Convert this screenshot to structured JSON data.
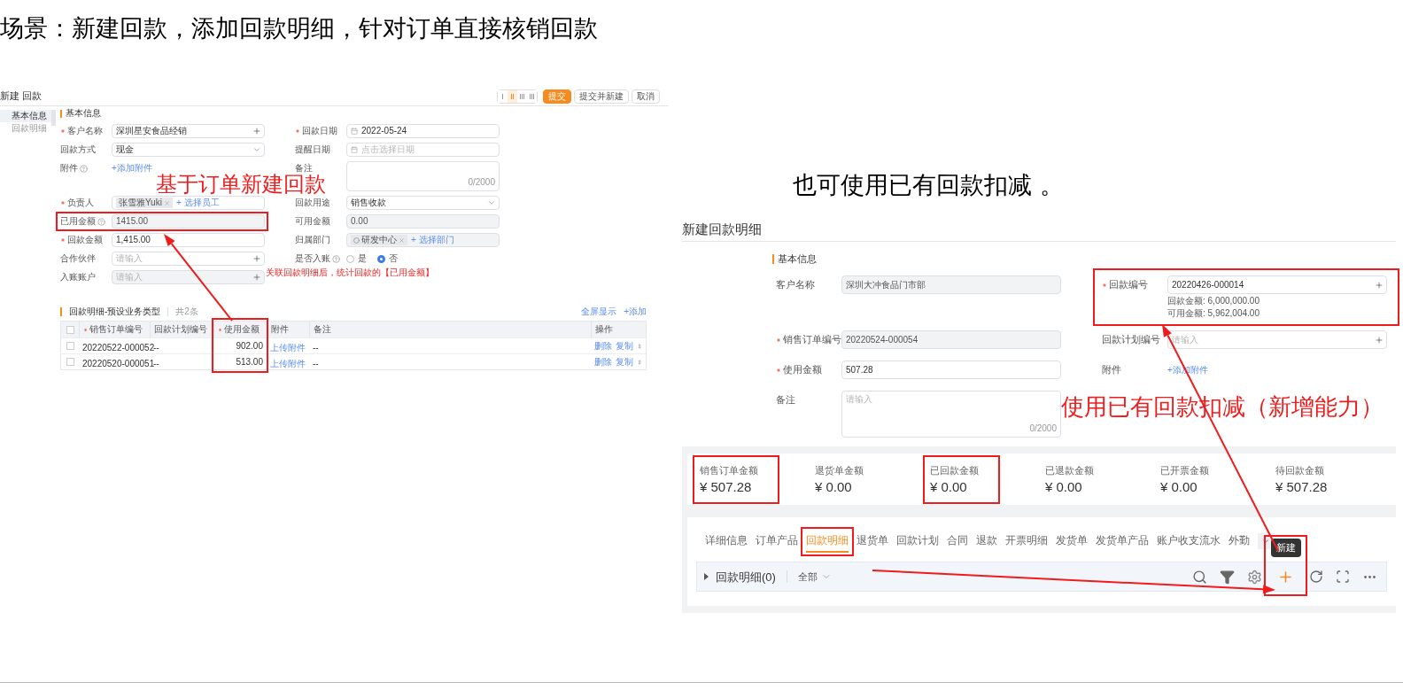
{
  "title": "场景：新建回款，添加回款明细，针对订单直接核销回款",
  "left_screen": {
    "title": "新建 回款",
    "layout_options": [
      {
        "selected": false
      },
      {
        "selected": true
      },
      {
        "selected": false
      },
      {
        "selected": false
      }
    ],
    "actions": [
      {
        "label": "提交",
        "kind": "primary"
      },
      {
        "label": "提交并新建",
        "kind": "default"
      },
      {
        "label": "取消",
        "kind": "default"
      }
    ],
    "nav": [
      {
        "label": "基本信息",
        "selected": true
      },
      {
        "label": "回款明细",
        "selected": false
      }
    ],
    "section": "基本信息",
    "rows": [
      {
        "left": {
          "label": "客户名称",
          "required": true,
          "kind": "plus",
          "value": "深圳星安食品经销"
        },
        "right": {
          "label": "回款日期",
          "required": true,
          "kind": "date",
          "value": "2022-05-24"
        }
      },
      {
        "left": {
          "label": "回款方式",
          "required": false,
          "kind": "select",
          "value": "现金"
        },
        "right": {
          "label": "提醒日期",
          "required": false,
          "kind": "date",
          "placeholder": "点击选择日期"
        }
      },
      {
        "left": {
          "label": "附件",
          "required": false,
          "help": true,
          "kind": "link",
          "value": "+添加附件"
        },
        "right": {
          "label": "备注",
          "required": false,
          "kind": "textarea",
          "count": "0/2000"
        }
      },
      {
        "left": {
          "label": "负责人",
          "required": true,
          "kind": "tags",
          "tags": [
            "张雪雅Yuki"
          ],
          "value": "+ 选择员工"
        },
        "right": {
          "label": "回款用途",
          "required": false,
          "kind": "select",
          "value": "销售收款"
        }
      },
      {
        "left": {
          "label": "已用金额",
          "required": false,
          "help": true,
          "kind": "input",
          "disabled": true,
          "highlighted": true,
          "value": "1415.00"
        },
        "right": {
          "label": "可用金额",
          "required": false,
          "kind": "input",
          "disabled": true,
          "value": "0.00"
        }
      },
      {
        "left": {
          "label": "回款金额",
          "required": true,
          "kind": "input",
          "value": "1,415.00"
        },
        "right": {
          "label": "归属部门",
          "required": false,
          "kind": "tags",
          "disabled": true,
          "tags": [
            "研发中心"
          ],
          "value": "+ 选择部门"
        }
      },
      {
        "left": {
          "label": "合作伙伴",
          "required": false,
          "kind": "plus",
          "placeholder": "请输入"
        },
        "right": {
          "label": "是否入账",
          "required": false,
          "help": true,
          "kind": "radio",
          "options": [
            {
              "label": "是",
              "selected": false
            },
            {
              "label": "否",
              "selected": true
            }
          ]
        }
      },
      {
        "left": {
          "label": "入账账户",
          "required": false,
          "kind": "plus",
          "disabled": true,
          "placeholder": "请输入"
        }
      }
    ],
    "detail_table": {
      "title": "回款明细-预设业务类型",
      "count": "共2条",
      "select_all_checked": false,
      "links": [
        "全屏显示",
        "+添加"
      ],
      "columns": [
        {
          "label": "销售订单编号",
          "required": true,
          "kind": "text"
        },
        {
          "label": "回款计划编号",
          "required": false,
          "kind": "text"
        },
        {
          "label": "使用金额",
          "required": true,
          "kind": "number",
          "highlighted": true
        },
        {
          "label": "附件",
          "required": false,
          "kind": "link"
        },
        {
          "label": "备注",
          "required": false,
          "kind": "text"
        },
        {
          "label": "操作",
          "required": false,
          "kind": "actions"
        }
      ],
      "rows": [
        {
          "checked": false,
          "cells": [
            "20220522-000052",
            "--",
            "902.00",
            "上传附件",
            "--"
          ],
          "actions": [
            "删除",
            "复制"
          ]
        },
        {
          "checked": false,
          "cells": [
            "20220520-000051",
            "--",
            "513.00",
            "上传附件",
            "--"
          ],
          "actions": [
            "删除",
            "复制"
          ]
        }
      ]
    }
  },
  "right_screen": {
    "title": "新建回款明细",
    "section": "基本信息",
    "rows": [
      {
        "left": {
          "label": "客户名称",
          "required": false,
          "kind": "input",
          "disabled": true,
          "value": "深圳大冲食品门市部"
        },
        "right": {
          "label": "回款编号",
          "required": true,
          "kind": "plus",
          "highlighted": true,
          "value": "20220426-000014",
          "notes": [
            "回款金额: 6,000,000.00",
            "可用金额: 5,962,004.00"
          ]
        }
      },
      {
        "left": {
          "label": "销售订单编号",
          "required": true,
          "kind": "input",
          "disabled": true,
          "value": "20220524-000054"
        },
        "right": {
          "label": "回款计划编号",
          "required": false,
          "kind": "plus",
          "placeholder": "请输入"
        }
      },
      {
        "left": {
          "label": "使用金额",
          "required": true,
          "kind": "input",
          "value": "507.28"
        },
        "right": {
          "label": "附件",
          "required": false,
          "kind": "link",
          "value": "+添加附件"
        }
      },
      {
        "left": {
          "label": "备注",
          "required": false,
          "kind": "textarea",
          "placeholder": "请输入",
          "count": "0/2000"
        }
      }
    ],
    "stats": [
      {
        "label": "销售订单金额",
        "value": "¥ 507.28",
        "highlighted": true
      },
      {
        "label": "退货单金额",
        "value": "¥ 0.00"
      },
      {
        "label": "已回款金额",
        "value": "¥ 0.00",
        "highlighted": true
      },
      {
        "label": "已退款金额",
        "value": "¥ 0.00"
      },
      {
        "label": "已开票金额",
        "value": "¥ 0.00"
      },
      {
        "label": "待回款金额",
        "value": "¥ 507.28"
      }
    ],
    "tabs": [
      {
        "label": "详细信息",
        "selected": false
      },
      {
        "label": "订单产品",
        "selected": false
      },
      {
        "label": "回款明细",
        "selected": true,
        "highlighted": true
      },
      {
        "label": "退货单",
        "selected": false
      },
      {
        "label": "回款计划",
        "selected": false
      },
      {
        "label": "合同",
        "selected": false
      },
      {
        "label": "退款",
        "selected": false
      },
      {
        "label": "开票明细",
        "selected": false
      },
      {
        "label": "发货单",
        "selected": false
      },
      {
        "label": "发货单产品",
        "selected": false
      },
      {
        "label": "账户收支流水",
        "selected": false
      },
      {
        "label": "外勤",
        "selected": false
      }
    ],
    "toolbar": {
      "title": "回款明细(0)",
      "filter": "全部",
      "tooltip": "新建",
      "add_highlighted": true
    }
  },
  "annotations": {
    "order_note": "基于订单新建回款",
    "used_amount_note": "关联回款明细后，统计回款的【已用金额】",
    "alt_note": "也可使用已有回款扣减 。",
    "new_note": "使用已有回款扣减（新增能力）"
  }
}
